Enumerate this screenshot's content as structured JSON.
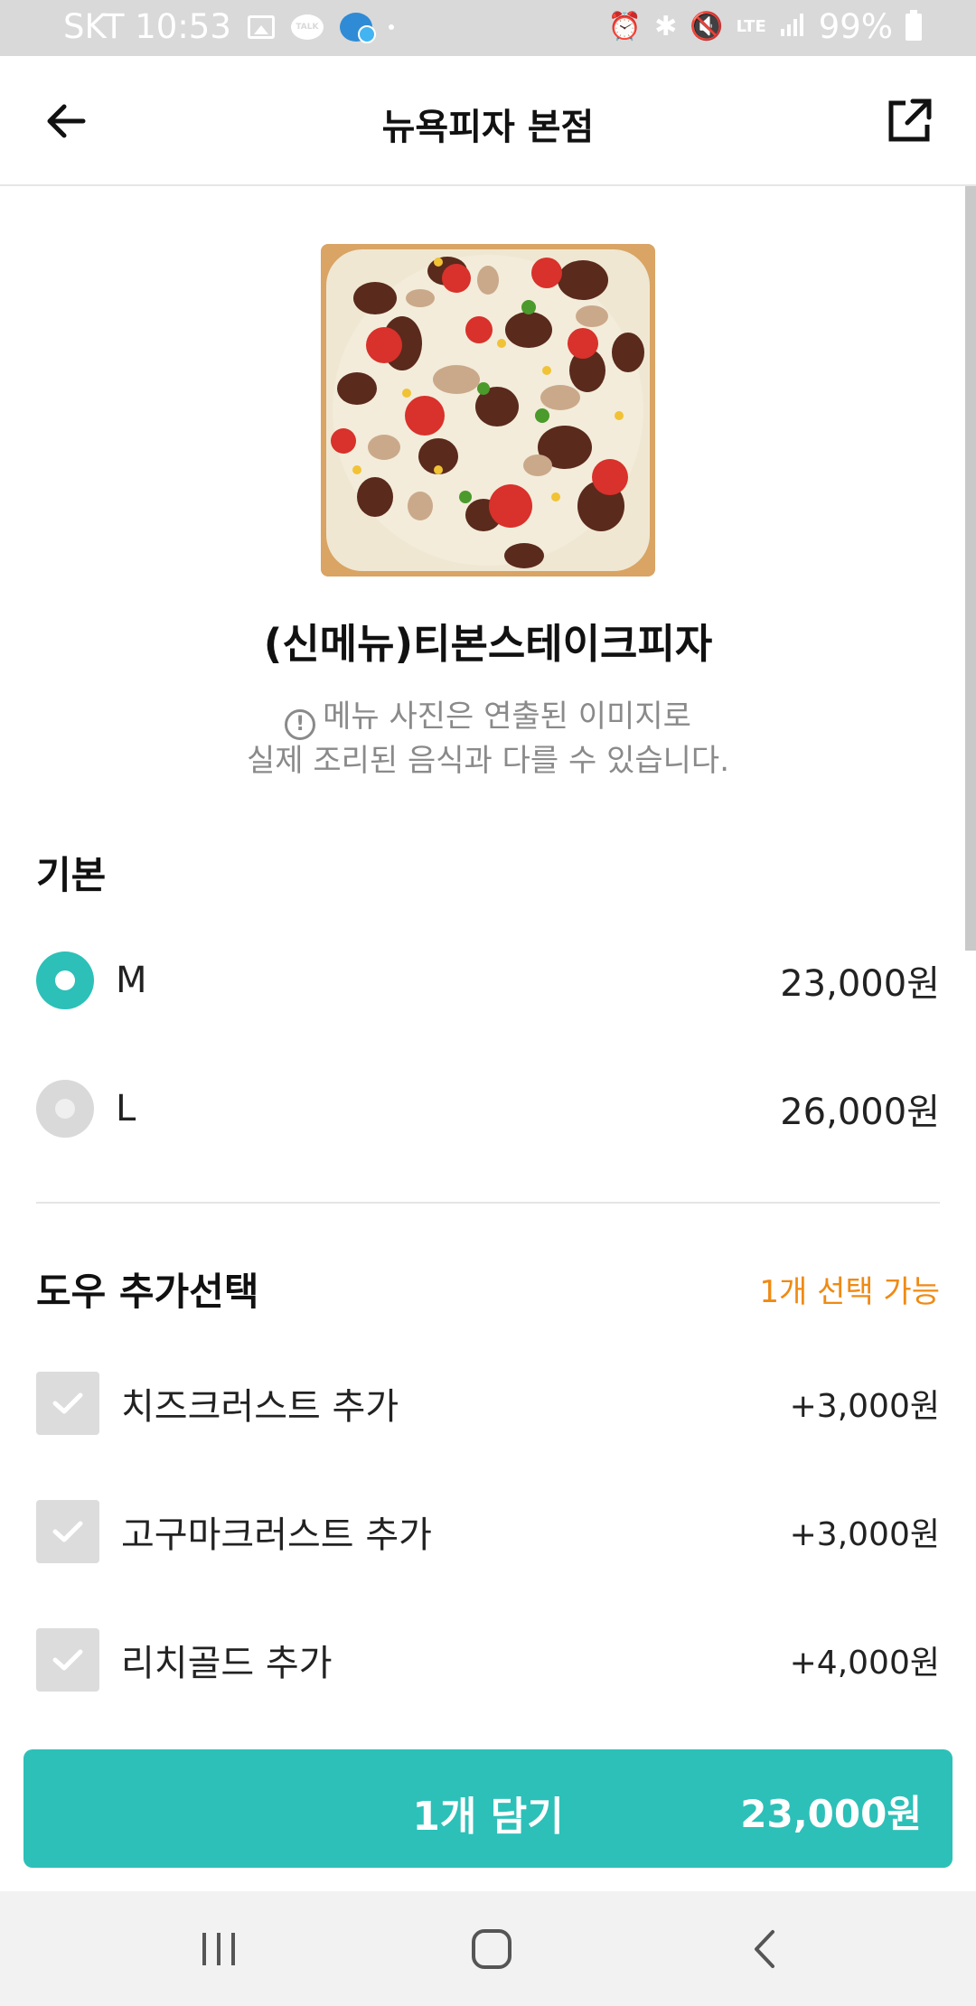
{
  "status_bar": {
    "carrier_time": "SKT 10:53",
    "talk_label": "TALK",
    "network": "LTE",
    "battery": "99%"
  },
  "header": {
    "title": "뉴욕피자 본점"
  },
  "menu": {
    "name": "(신메뉴)티본스테이크피자",
    "notice_icon": "!",
    "notice_line1": "메뉴 사진은 연출된 이미지로",
    "notice_line2": "실제 조리된 음식과 다를 수 있습니다."
  },
  "basic_section": {
    "title": "기본",
    "options": [
      {
        "label": "M",
        "price": "23,000원",
        "selected": true
      },
      {
        "label": "L",
        "price": "26,000원",
        "selected": false
      }
    ]
  },
  "dough_section": {
    "title": "도우 추가선택",
    "note": "1개 선택 가능",
    "options": [
      {
        "label": "치즈크러스트 추가",
        "price": "+3,000원"
      },
      {
        "label": "고구마크러스트 추가",
        "price": "+3,000원"
      },
      {
        "label": "리치골드 추가",
        "price": "+4,000원"
      }
    ]
  },
  "cta": {
    "label": "1개 담기",
    "price": "23,000원"
  },
  "colors": {
    "accent": "#2cc0b8",
    "note": "#ef8a14"
  }
}
